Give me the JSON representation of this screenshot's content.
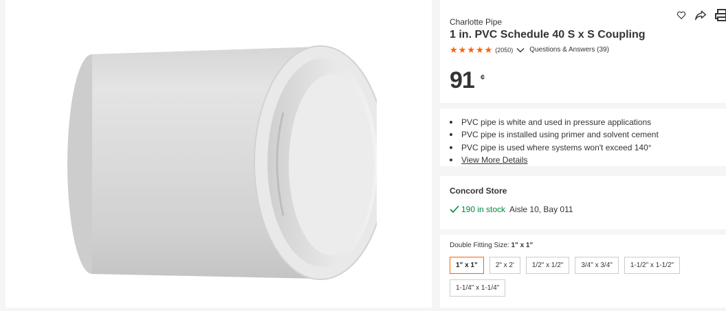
{
  "product": {
    "brand": "Charlotte Pipe",
    "title": "1 in. PVC Schedule 40 S x S Coupling",
    "rating_stars": 5,
    "review_count": "(2050)",
    "qa_label": "Questions & Answers (39)",
    "price_whole": "91",
    "price_cents": "¢",
    "image_alt": "PVC coupling"
  },
  "actions": {
    "icons": [
      "heart-icon",
      "share-icon",
      "print-icon"
    ]
  },
  "highlights": {
    "items": [
      "PVC pipe is white and used in pressure applications",
      "PVC pipe is installed using primer and solvent cement",
      "PVC pipe is used where systems won't exceed 140°"
    ],
    "more_label": "View More Details"
  },
  "store": {
    "name": "Concord Store",
    "stock": "190 in stock",
    "aisle": "Aisle 10, Bay 011"
  },
  "size_selector": {
    "label": "Double Fitting Size:",
    "selected": "1\" x 1\"",
    "options": [
      "1\" x 1\"",
      "2\" x 2'",
      "1/2\" x 1/2\"",
      "3/4\" x 3/4\"",
      "1-1/2\" x 1-1/2\"",
      "1-1/4\" x 1-1/4\""
    ]
  },
  "colors": {
    "accent": "#f96302",
    "stock_green": "#00873c",
    "text": "#333333"
  }
}
